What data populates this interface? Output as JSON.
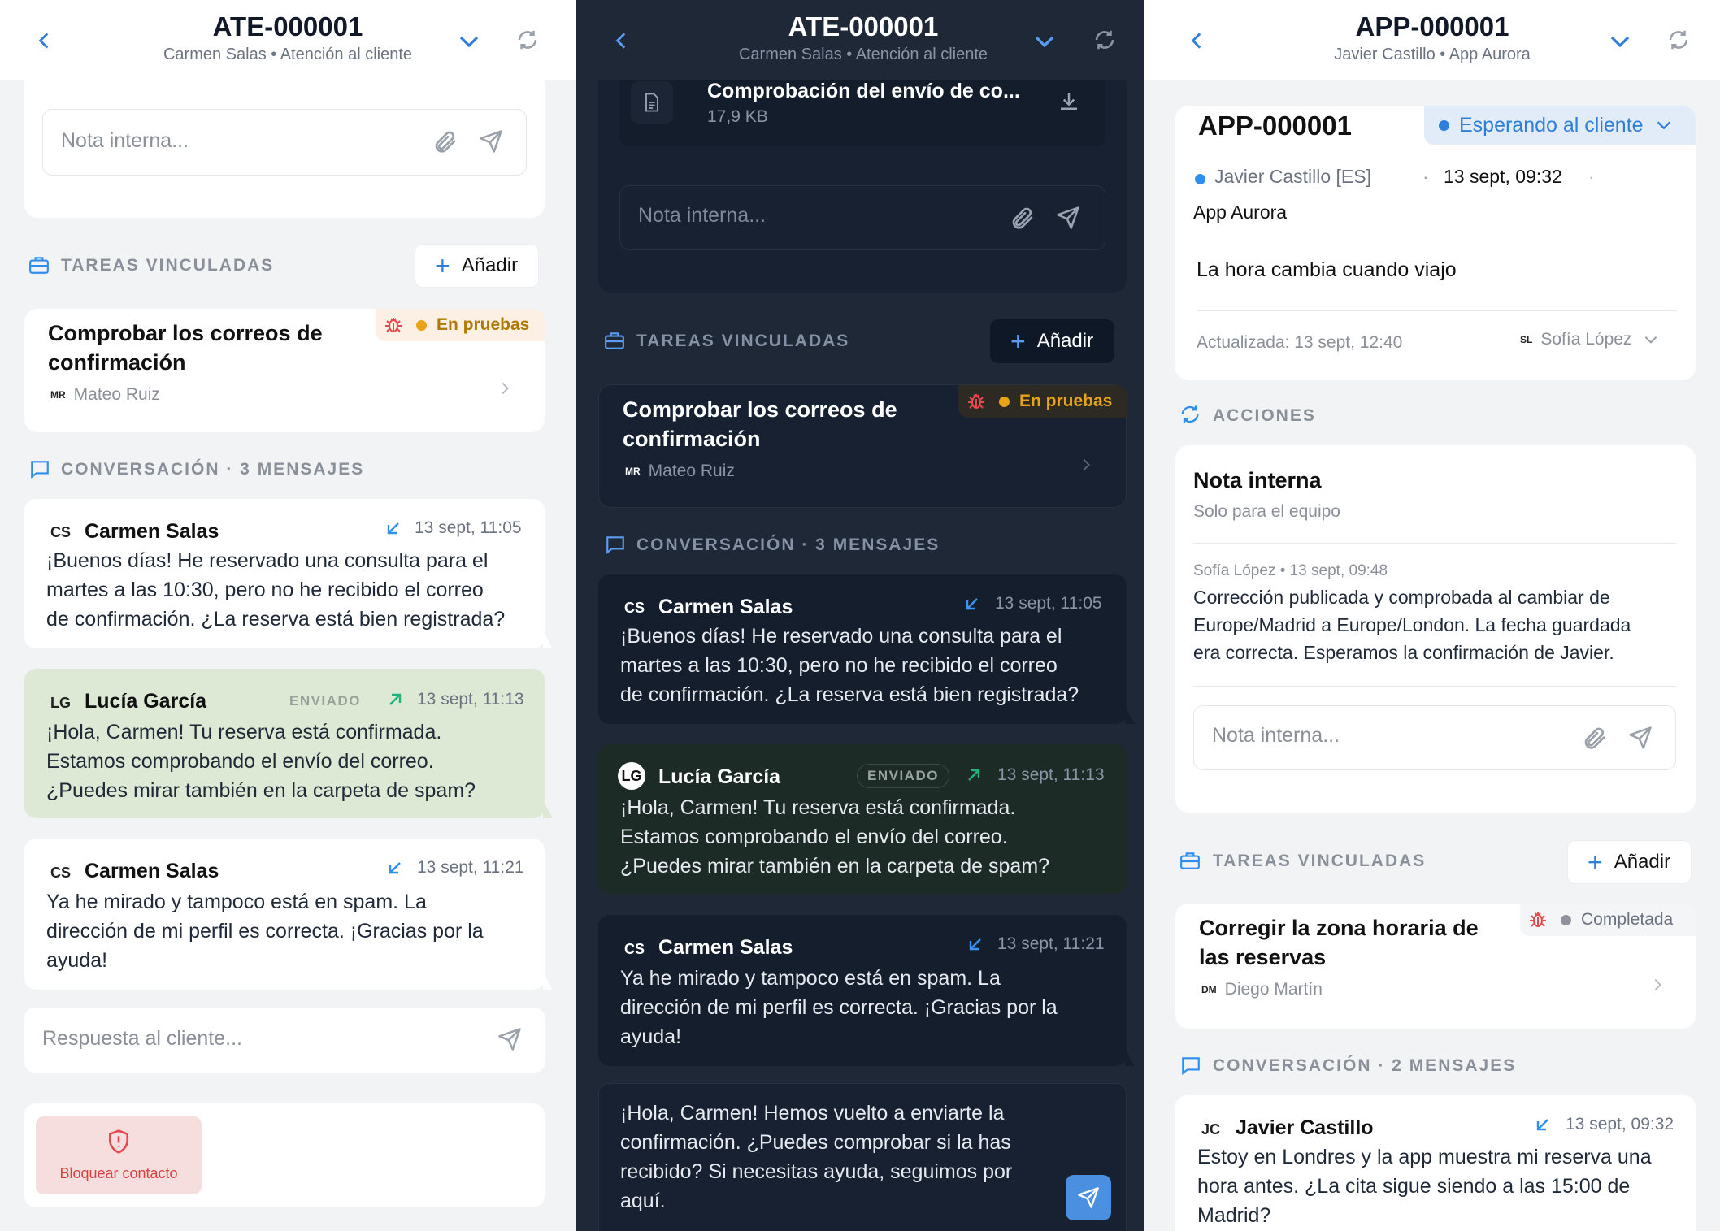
{
  "colors": {
    "accent": "#2f7fd8",
    "bug": "#e5484d",
    "testing": "#e8a317",
    "done": "#8f949c",
    "sent_arrow": "#20b27a",
    "in_arrow": "#2f8ff0",
    "danger": "#e5484d"
  },
  "icons": [
    "chevron-left-icon",
    "chevron-down-icon",
    "refresh-icon",
    "paperclip-icon",
    "send-icon",
    "briefcase-icon",
    "chat-icon",
    "bug-icon",
    "chevron-right-icon",
    "incoming-arrow-icon",
    "outgoing-arrow-icon",
    "shield-icon",
    "document-icon",
    "download-icon",
    "sync-icon"
  ],
  "panel1": {
    "header": {
      "title": "ATE-000001",
      "subtitle": "Carmen Salas • Atención al cliente"
    },
    "note_placeholder": "Nota interna...",
    "tasks_heading": "TAREAS VINCULADAS",
    "add_label": "Añadir",
    "task": {
      "title_l1": "Comprobar los correos de",
      "title_l2": "confirmación",
      "assignee_initials": "MR",
      "assignee": "Mateo Ruiz",
      "status": "En pruebas"
    },
    "conversation_heading": "CONVERSACIÓN · 3 MENSAJES",
    "messages": [
      {
        "initials": "CS",
        "name": "Carmen Salas",
        "time": "13 sept, 11:05",
        "lines": [
          "¡Buenos días! He reservado una consulta para el",
          "martes a las 10:30, pero no he recibido el correo",
          "de confirmación. ¿La reserva está bien registrada?"
        ]
      },
      {
        "initials": "LG",
        "name": "Lucía García",
        "sent": "ENVIADO",
        "time": "13 sept, 11:13",
        "lines": [
          "¡Hola, Carmen! Tu reserva está confirmada.",
          "Estamos comprobando el envío del correo.",
          "¿Puedes mirar también en la carpeta de spam?"
        ]
      },
      {
        "initials": "CS",
        "name": "Carmen Salas",
        "time": "13 sept, 11:21",
        "lines": [
          "Ya he mirado y tampoco está en spam. La",
          "dirección de mi perfil es correcta. ¡Gracias por la",
          "ayuda!"
        ]
      }
    ],
    "reply_placeholder": "Respuesta al cliente...",
    "block_label": "Bloquear contacto"
  },
  "panel2": {
    "header": {
      "title": "ATE-000001",
      "subtitle": "Carmen Salas • Atención al cliente"
    },
    "attachment": {
      "name": "Comprobación del envío de co...",
      "size": "17,9 KB"
    },
    "note_placeholder": "Nota interna...",
    "tasks_heading": "TAREAS VINCULADAS",
    "add_label": "Añadir",
    "task": {
      "title_l1": "Comprobar los correos de",
      "title_l2": "confirmación",
      "assignee_initials": "MR",
      "assignee": "Mateo Ruiz",
      "status": "En pruebas"
    },
    "conversation_heading": "CONVERSACIÓN · 3 MENSAJES",
    "messages": [
      {
        "initials": "CS",
        "name": "Carmen Salas",
        "time": "13 sept, 11:05",
        "lines": [
          "¡Buenos días! He reservado una consulta para el",
          "martes a las 10:30, pero no he recibido el correo",
          "de confirmación. ¿La reserva está bien registrada?"
        ]
      },
      {
        "initials": "LG",
        "name": "Lucía García",
        "sent": "ENVIADO",
        "time": "13 sept, 11:13",
        "lines": [
          "¡Hola, Carmen! Tu reserva está confirmada.",
          "Estamos comprobando el envío del correo.",
          "¿Puedes mirar también en la carpeta de spam?"
        ]
      },
      {
        "initials": "CS",
        "name": "Carmen Salas",
        "time": "13 sept, 11:21",
        "lines": [
          "Ya he mirado y tampoco está en spam. La",
          "dirección de mi perfil es correcta. ¡Gracias por la",
          "ayuda!"
        ]
      }
    ],
    "draft_lines": [
      "¡Hola, Carmen! Hemos vuelto a enviarte la",
      "confirmación. ¿Puedes comprobar si la has",
      "recibido? Si necesitas ayuda, seguimos por",
      "aquí."
    ]
  },
  "panel3": {
    "header": {
      "title": "APP-000001",
      "subtitle": "Javier Castillo • App Aurora"
    },
    "ticket": {
      "id": "APP-000001",
      "status": "Esperando al cliente",
      "requester": "Javier Castillo [ES]",
      "date": "13 sept, 09:32",
      "app": "App Aurora",
      "summary": "La hora cambia cuando viajo",
      "updated": "Actualizada: 13 sept, 12:40",
      "assignee_initials": "SL",
      "assignee": "Sofía López"
    },
    "actions_heading": "ACCIONES",
    "note": {
      "title": "Nota interna",
      "subtitle": "Solo para el equipo",
      "meta": "Sofía López • 13 sept, 09:48",
      "lines": [
        "Corrección publicada y comprobada al cambiar de",
        "Europe/Madrid a Europe/London. La fecha guardada",
        "era correcta. Esperamos la confirmación de Javier."
      ],
      "placeholder": "Nota interna..."
    },
    "tasks_heading": "TAREAS VINCULADAS",
    "add_label": "Añadir",
    "task": {
      "title_l1": "Corregir la zona horaria de",
      "title_l2": "las reservas",
      "assignee_initials": "DM",
      "assignee": "Diego Martín",
      "status": "Completada"
    },
    "conversation_heading": "CONVERSACIÓN · 2 MENSAJES",
    "messages": [
      {
        "initials": "JC",
        "name": "Javier Castillo",
        "time": "13 sept, 09:32",
        "lines": [
          "Estoy en Londres y la app muestra mi reserva una",
          "hora antes. ¿La cita sigue siendo a las 15:00 de",
          "Madrid?"
        ]
      }
    ]
  }
}
